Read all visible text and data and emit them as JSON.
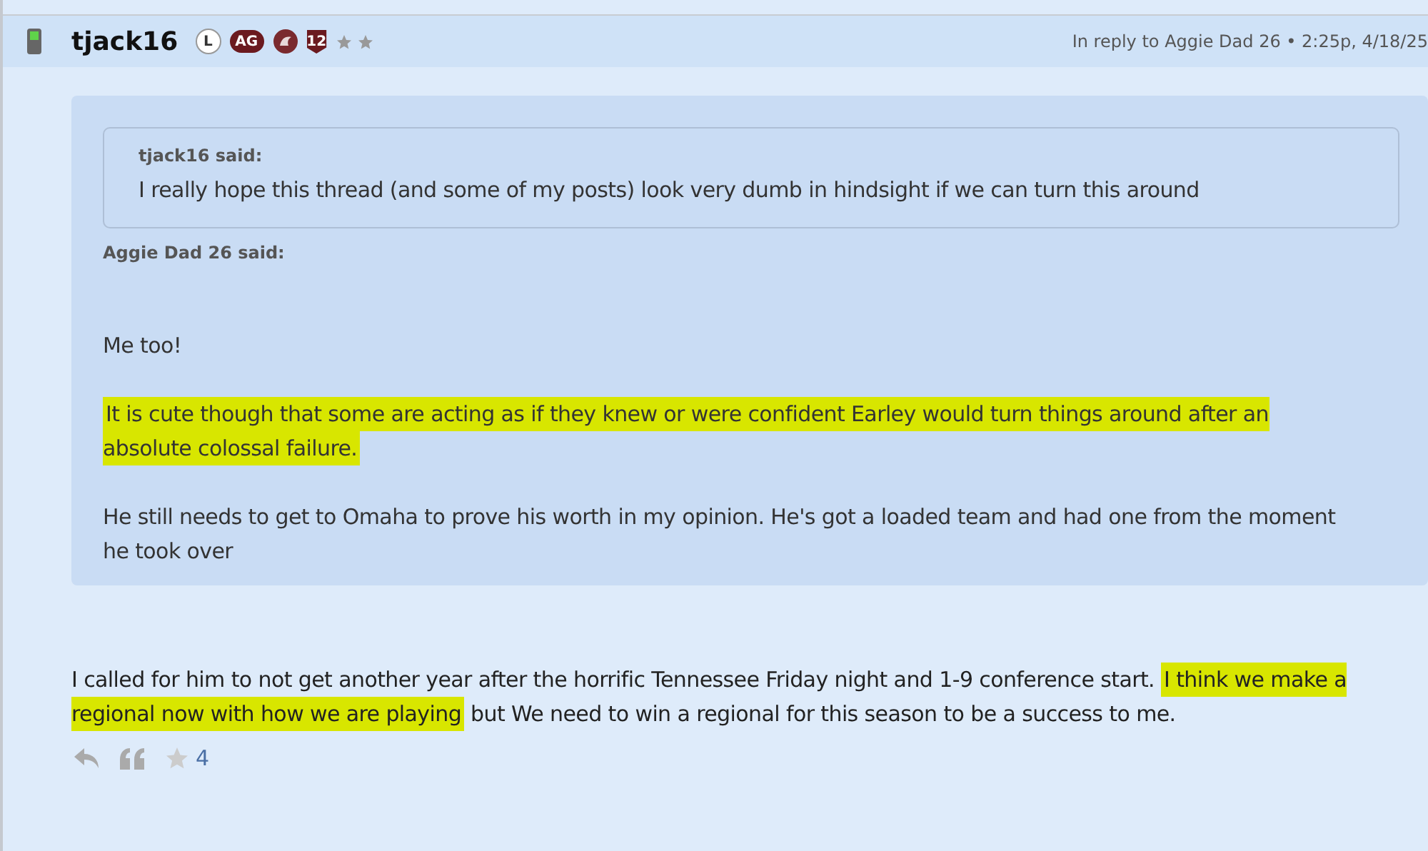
{
  "post": {
    "username": "tjack16",
    "badges": [
      {
        "kind": "letter",
        "text": "L"
      },
      {
        "kind": "pill",
        "text": "AG"
      },
      {
        "kind": "mascot"
      },
      {
        "kind": "shield",
        "text": "12"
      },
      {
        "kind": "stars"
      }
    ],
    "reply_info": "In reply to Aggie Dad 26 • 2:25p, 4/18/25",
    "quote": {
      "inner_author": "tjack16 said:",
      "inner_text": "I really hope this thread (and some of my posts) look very dumb in hindsight if we can turn this around",
      "author": "Aggie Dad 26 said:",
      "paragraphs": [
        [
          {
            "text": "Me too!",
            "highlighted": false
          }
        ],
        [
          {
            "text": "It is cute though that some are acting as if they knew or were confident Earley would turn things around after an absolute colossal failure.",
            "highlighted": true
          }
        ],
        [
          {
            "text": "He still needs to get to Omaha to prove his worth in my opinion. He's got a loaded team and had one from the moment he took over",
            "highlighted": false
          }
        ]
      ]
    },
    "body": [
      {
        "text": "I called for him to not get another year after the horrific Tennessee Friday night and 1-9 conference start. ",
        "highlighted": false
      },
      {
        "text": "I think we make a regional now with how we are playing",
        "highlighted": true
      },
      {
        "text": " but We need to win a regional for this season to be a success to me.",
        "highlighted": false
      }
    ],
    "like_count": "4"
  }
}
